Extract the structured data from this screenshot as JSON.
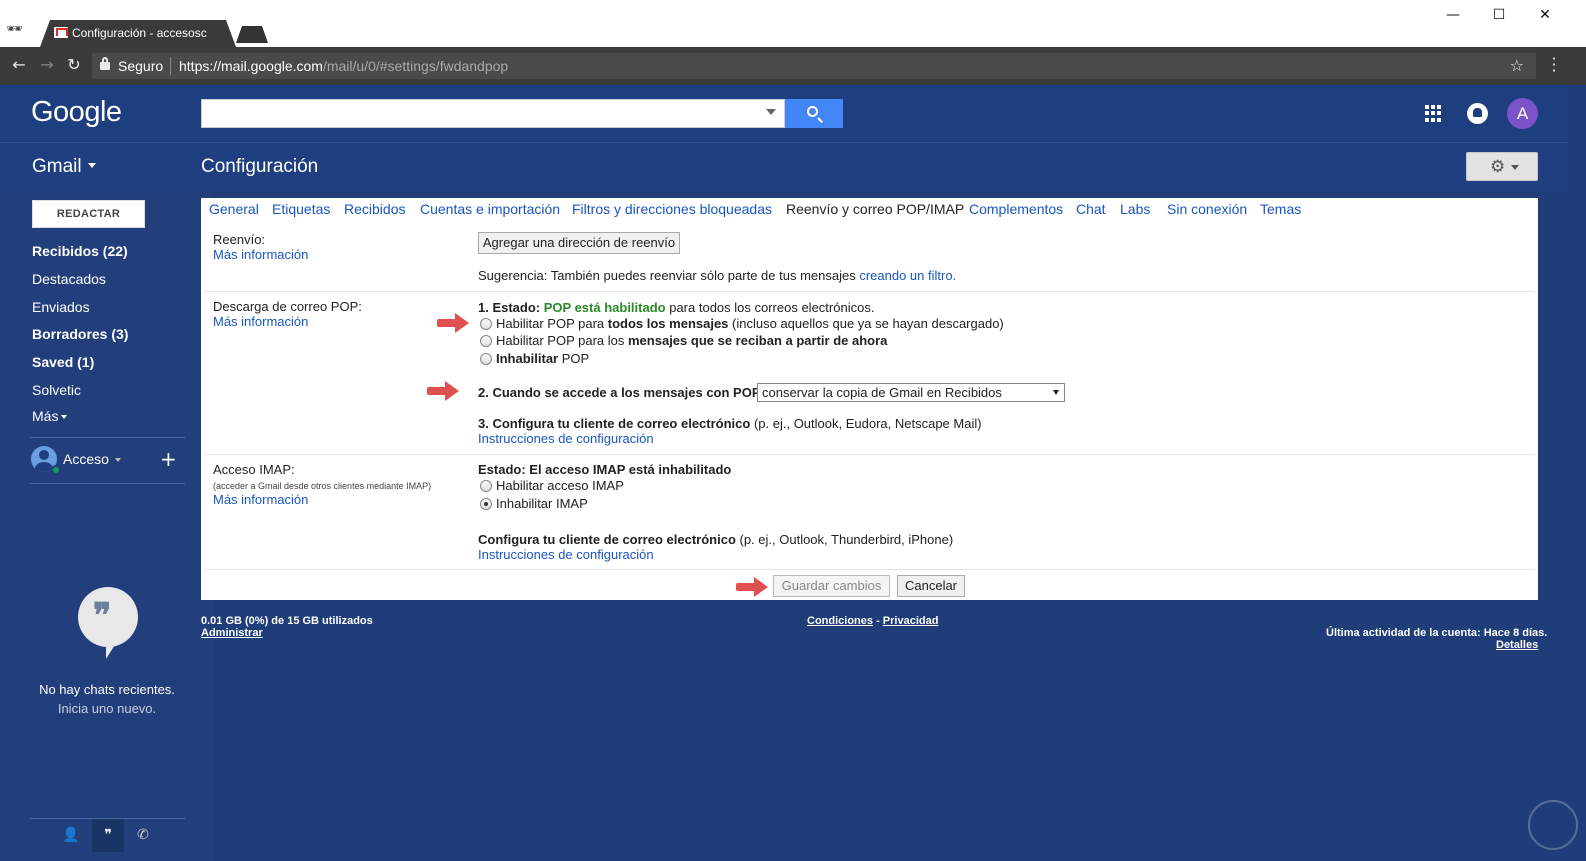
{
  "browser": {
    "tab_title": "Configuración - accesosc",
    "tab_close": "×",
    "secure_label": "Seguro",
    "url_host": "https://mail.google.com",
    "url_path": "/mail/u/0/#settings/fwdandpop",
    "window_controls": {
      "minimize": "—",
      "maximize": "☐",
      "close": "✕"
    }
  },
  "header": {
    "logo": "Google",
    "app_label": "Gmail",
    "page_title": "Configuración",
    "avatar_letter": "A"
  },
  "sidebar": {
    "compose": "REDACTAR",
    "items": [
      {
        "label": "Recibidos (22)",
        "bold": true
      },
      {
        "label": "Destacados",
        "bold": false
      },
      {
        "label": "Enviados",
        "bold": false
      },
      {
        "label": "Borradores (3)",
        "bold": true
      },
      {
        "label": "Saved (1)",
        "bold": true
      },
      {
        "label": "Solvetic",
        "bold": false
      },
      {
        "label": "Más",
        "bold": false
      }
    ],
    "chat_user": "Acceso",
    "add_symbol": "+",
    "no_chats": "No hay chats recientes.",
    "start_new": "Inicia uno nuevo."
  },
  "settings_tabs": [
    "General",
    "Etiquetas",
    "Recibidos",
    "Cuentas e importación",
    "Filtros y direcciones bloqueadas",
    "Reenvío y correo POP/IMAP",
    "Complementos",
    "Chat",
    "Labs",
    "Sin conexión",
    "Temas"
  ],
  "active_tab": "Reenvío y correo POP/IMAP",
  "forwarding": {
    "label": "Reenvío:",
    "more_info": "Más información",
    "add_button": "Agregar una dirección de reenvío",
    "tip_prefix": "Sugerencia: También puedes reenviar sólo parte de tus mensajes ",
    "tip_link": "creando un filtro."
  },
  "pop": {
    "label": "Descarga de correo POP:",
    "more_info": "Más información",
    "status_prefix": "1. Estado: ",
    "status_value": "POP está habilitado",
    "status_suffix": " para todos los correos electrónicos.",
    "option1_pre": "Habilitar POP para ",
    "option1_bold": "todos los mensajes",
    "option1_post": " (incluso aquellos que ya se hayan descargado)",
    "option2_pre": "Habilitar POP para los ",
    "option2_bold": "mensajes que se reciban a partir de ahora",
    "option3_bold": "Inhabilitar",
    "option3_post": " POP",
    "when_access": "2. Cuando se accede a los mensajes con POP",
    "when_select": "conservar la copia de Gmail en Recibidos",
    "configure_bold": "3. Configura tu cliente de correo electrónico",
    "configure_rest": " (p. ej., Outlook, Eudora, Netscape Mail)",
    "instructions": "Instrucciones de configuración"
  },
  "imap": {
    "label": "Acceso IMAP:",
    "note": "(acceder a Gmail desde otros clientes mediante IMAP)",
    "more_info": "Más información",
    "status": "Estado: El acceso IMAP está inhabilitado",
    "option_enable": "Habilitar acceso IMAP",
    "option_disable": "Inhabilitar IMAP",
    "configure_bold": "Configura tu cliente de correo electrónico",
    "configure_rest": " (p. ej., Outlook, Thunderbird, iPhone)",
    "instructions": "Instrucciones de configuración"
  },
  "actions": {
    "save": "Guardar cambios",
    "cancel": "Cancelar"
  },
  "footer": {
    "storage": "0.01 GB (0%) de 15 GB utilizados",
    "manage": "Administrar",
    "terms": "Condiciones",
    "separator": " - ",
    "privacy": "Privacidad",
    "last_activity": "Última actividad de la cuenta: Hace 8 días.",
    "details": "Detalles"
  },
  "colors": {
    "header_bg": "#1d3e7f",
    "link": "#1a55c0",
    "search_btn": "#4285f4",
    "pop_enabled": "#2a8a2a",
    "arrow": "#e05050"
  },
  "icons": [
    "incognito-icon",
    "back-icon",
    "forward-icon",
    "reload-icon",
    "lock-icon",
    "star-icon",
    "menu-icon",
    "search-icon",
    "apps-icon",
    "notifications-icon",
    "gear-icon",
    "hangouts-icon",
    "person-icon",
    "phone-icon"
  ]
}
